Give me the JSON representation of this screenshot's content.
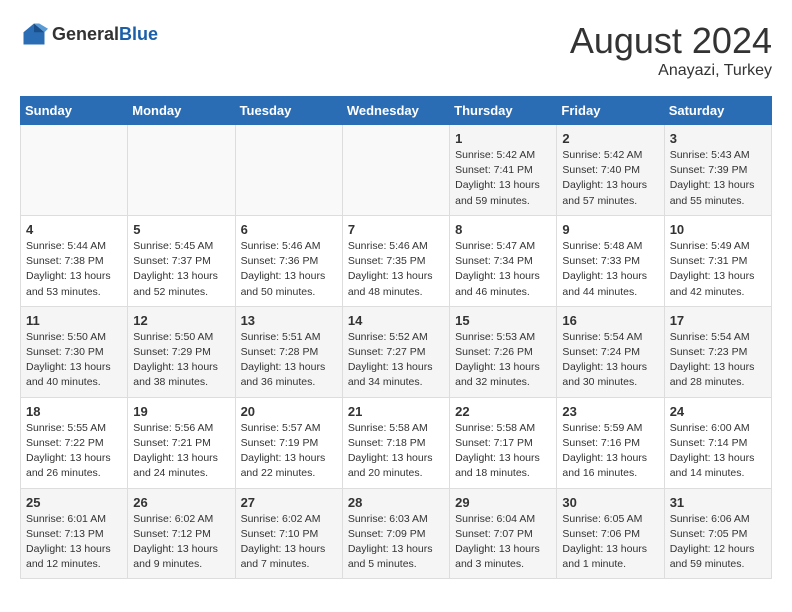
{
  "header": {
    "logo_general": "General",
    "logo_blue": "Blue",
    "month_year": "August 2024",
    "location": "Anayazi, Turkey"
  },
  "days_of_week": [
    "Sunday",
    "Monday",
    "Tuesday",
    "Wednesday",
    "Thursday",
    "Friday",
    "Saturday"
  ],
  "weeks": [
    [
      {
        "day": "",
        "info": ""
      },
      {
        "day": "",
        "info": ""
      },
      {
        "day": "",
        "info": ""
      },
      {
        "day": "",
        "info": ""
      },
      {
        "day": "1",
        "info": "Sunrise: 5:42 AM\nSunset: 7:41 PM\nDaylight: 13 hours\nand 59 minutes."
      },
      {
        "day": "2",
        "info": "Sunrise: 5:42 AM\nSunset: 7:40 PM\nDaylight: 13 hours\nand 57 minutes."
      },
      {
        "day": "3",
        "info": "Sunrise: 5:43 AM\nSunset: 7:39 PM\nDaylight: 13 hours\nand 55 minutes."
      }
    ],
    [
      {
        "day": "4",
        "info": "Sunrise: 5:44 AM\nSunset: 7:38 PM\nDaylight: 13 hours\nand 53 minutes."
      },
      {
        "day": "5",
        "info": "Sunrise: 5:45 AM\nSunset: 7:37 PM\nDaylight: 13 hours\nand 52 minutes."
      },
      {
        "day": "6",
        "info": "Sunrise: 5:46 AM\nSunset: 7:36 PM\nDaylight: 13 hours\nand 50 minutes."
      },
      {
        "day": "7",
        "info": "Sunrise: 5:46 AM\nSunset: 7:35 PM\nDaylight: 13 hours\nand 48 minutes."
      },
      {
        "day": "8",
        "info": "Sunrise: 5:47 AM\nSunset: 7:34 PM\nDaylight: 13 hours\nand 46 minutes."
      },
      {
        "day": "9",
        "info": "Sunrise: 5:48 AM\nSunset: 7:33 PM\nDaylight: 13 hours\nand 44 minutes."
      },
      {
        "day": "10",
        "info": "Sunrise: 5:49 AM\nSunset: 7:31 PM\nDaylight: 13 hours\nand 42 minutes."
      }
    ],
    [
      {
        "day": "11",
        "info": "Sunrise: 5:50 AM\nSunset: 7:30 PM\nDaylight: 13 hours\nand 40 minutes."
      },
      {
        "day": "12",
        "info": "Sunrise: 5:50 AM\nSunset: 7:29 PM\nDaylight: 13 hours\nand 38 minutes."
      },
      {
        "day": "13",
        "info": "Sunrise: 5:51 AM\nSunset: 7:28 PM\nDaylight: 13 hours\nand 36 minutes."
      },
      {
        "day": "14",
        "info": "Sunrise: 5:52 AM\nSunset: 7:27 PM\nDaylight: 13 hours\nand 34 minutes."
      },
      {
        "day": "15",
        "info": "Sunrise: 5:53 AM\nSunset: 7:26 PM\nDaylight: 13 hours\nand 32 minutes."
      },
      {
        "day": "16",
        "info": "Sunrise: 5:54 AM\nSunset: 7:24 PM\nDaylight: 13 hours\nand 30 minutes."
      },
      {
        "day": "17",
        "info": "Sunrise: 5:54 AM\nSunset: 7:23 PM\nDaylight: 13 hours\nand 28 minutes."
      }
    ],
    [
      {
        "day": "18",
        "info": "Sunrise: 5:55 AM\nSunset: 7:22 PM\nDaylight: 13 hours\nand 26 minutes."
      },
      {
        "day": "19",
        "info": "Sunrise: 5:56 AM\nSunset: 7:21 PM\nDaylight: 13 hours\nand 24 minutes."
      },
      {
        "day": "20",
        "info": "Sunrise: 5:57 AM\nSunset: 7:19 PM\nDaylight: 13 hours\nand 22 minutes."
      },
      {
        "day": "21",
        "info": "Sunrise: 5:58 AM\nSunset: 7:18 PM\nDaylight: 13 hours\nand 20 minutes."
      },
      {
        "day": "22",
        "info": "Sunrise: 5:58 AM\nSunset: 7:17 PM\nDaylight: 13 hours\nand 18 minutes."
      },
      {
        "day": "23",
        "info": "Sunrise: 5:59 AM\nSunset: 7:16 PM\nDaylight: 13 hours\nand 16 minutes."
      },
      {
        "day": "24",
        "info": "Sunrise: 6:00 AM\nSunset: 7:14 PM\nDaylight: 13 hours\nand 14 minutes."
      }
    ],
    [
      {
        "day": "25",
        "info": "Sunrise: 6:01 AM\nSunset: 7:13 PM\nDaylight: 13 hours\nand 12 minutes."
      },
      {
        "day": "26",
        "info": "Sunrise: 6:02 AM\nSunset: 7:12 PM\nDaylight: 13 hours\nand 9 minutes."
      },
      {
        "day": "27",
        "info": "Sunrise: 6:02 AM\nSunset: 7:10 PM\nDaylight: 13 hours\nand 7 minutes."
      },
      {
        "day": "28",
        "info": "Sunrise: 6:03 AM\nSunset: 7:09 PM\nDaylight: 13 hours\nand 5 minutes."
      },
      {
        "day": "29",
        "info": "Sunrise: 6:04 AM\nSunset: 7:07 PM\nDaylight: 13 hours\nand 3 minutes."
      },
      {
        "day": "30",
        "info": "Sunrise: 6:05 AM\nSunset: 7:06 PM\nDaylight: 13 hours\nand 1 minute."
      },
      {
        "day": "31",
        "info": "Sunrise: 6:06 AM\nSunset: 7:05 PM\nDaylight: 12 hours\nand 59 minutes."
      }
    ]
  ]
}
